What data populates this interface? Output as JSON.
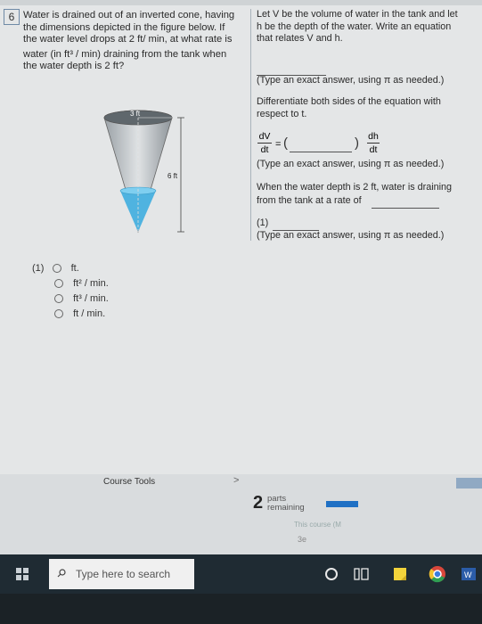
{
  "question": {
    "number": "6",
    "text_lines": [
      "Water is drained out of an inverted cone, having",
      "the dimensions depicted in the figure below. If",
      "the water level drops at 2 ft/ min, at what rate is",
      "water (in ft³ / min) draining from the tank when",
      "the water depth is 2 ft?"
    ]
  },
  "figure": {
    "top_label": "3 ft",
    "height_label": "6 ft"
  },
  "part1": {
    "label": "(1)",
    "options": [
      "ft.",
      "ft² / min.",
      "ft³ / min.",
      "ft / min."
    ]
  },
  "right": {
    "intro_lines": [
      "Let V be the volume of water in the tank and let",
      "h be the depth of the water. Write an equation",
      "that relates V and h."
    ],
    "hint1": "(Type an exact answer, using π as needed.)",
    "differentiate_lines": [
      "Differentiate both sides of the equation with",
      "respect to t."
    ],
    "dV": "dV",
    "dt": "dt",
    "dh": "dh",
    "equals": "=",
    "paren_open": "(",
    "paren_close": ")",
    "hint2": "(Type an exact answer, using π as needed.)",
    "rate_lines": [
      "When the water depth is 2 ft, water is draining",
      "from the tank at a rate of"
    ],
    "answer_label": "(1)",
    "hint3": "(Type an exact answer, using π as needed.)"
  },
  "bottom": {
    "course_tools": "Course Tools",
    "chevron": ">",
    "parts_count": "2",
    "parts_label_1": "parts",
    "parts_label_2": "remaining",
    "ghost1": "This course (M",
    "ghost2": "3e"
  },
  "taskbar": {
    "search_placeholder": "Type here to search"
  },
  "colors": {
    "accent": "#1f70c4",
    "taskbar": "#1f2b33",
    "water": "#4fb3e0"
  }
}
